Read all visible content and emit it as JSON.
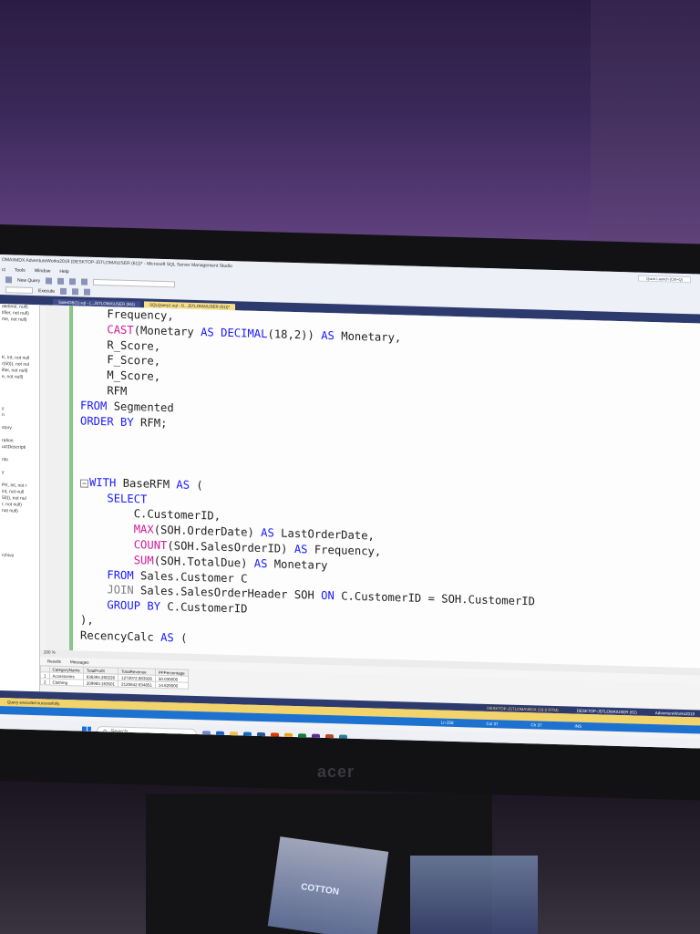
{
  "window": {
    "title": "OMAI\\MDX AdventureWorks2019 (DESKTOP-J5TLOMA\\USER (61))* - Microsoft SQL Server Management Studio",
    "quick_launch": "Quick Launch (Ctrl+Q)"
  },
  "menu": [
    "ct",
    "Tools",
    "Window",
    "Help"
  ],
  "toolbar": {
    "new_query": "New Query",
    "execute": "Execute"
  },
  "tabs": [
    {
      "label": "SalesDB(1).sql - (...J5TLOMA\\USER (65))",
      "active": false
    },
    {
      "label": "SQLQuery1.sql - D...J5TLOMA\\USER (61))*",
      "active": true
    }
  ],
  "object_explorer": {
    "lines": [
      "atetime, null)",
      "tifier, not null)",
      "me, not null)",
      "",
      "",
      "",
      "",
      "",
      "K, int, not null",
      "r(50)), not nul",
      "ifier, not null)",
      "e, not null)",
      "",
      "",
      "",
      "",
      "y",
      "n",
      "",
      "story",
      "",
      "ration",
      "uctDescripti",
      "",
      "nto",
      "",
      "y",
      "",
      "PK, int, not r",
      "int, not null",
      "50)), not nul",
      "r, not null)",
      " not null)",
      "",
      "",
      "",
      "",
      "",
      "",
      "rchive"
    ]
  },
  "code_lines": [
    "    Frequency,",
    "    CAST(Monetary AS DECIMAL(18,2)) AS Monetary,",
    "    R_Score,",
    "    F_Score,",
    "    M_Score,",
    "    RFM",
    "FROM Segmented",
    "ORDER BY RFM;",
    "",
    "",
    "",
    "WITH BaseRFM AS (",
    "    SELECT",
    "        C.CustomerID,",
    "        MAX(SOH.OrderDate) AS LastOrderDate,",
    "        COUNT(SOH.SalesOrderID) AS Frequency,",
    "        SUM(SOH.TotalDue) AS Monetary",
    "    FROM Sales.Customer C",
    "    JOIN Sales.SalesOrderHeader SOH ON C.CustomerID = SOH.CustomerID",
    "    GROUP BY C.CustomerID",
    "),",
    "RecencyCalc AS ("
  ],
  "zoom": "200 %",
  "results": {
    "tabs": [
      "Results",
      "Messages"
    ],
    "columns": [
      "",
      "CategoryName",
      "TotalProfit",
      "TotalRevenue",
      "PFPercentage"
    ],
    "rows": [
      [
        "1",
        "Accessories",
        "636394.260226",
        "1272072.883926",
        "50.030000"
      ],
      [
        "2",
        "Clothing",
        "209983.163501",
        "2120642.634851",
        "14.620000"
      ]
    ]
  },
  "connection_bar": {
    "server": "DESKTOP-J5TLOMA\\MDX (16.0 RTM)",
    "user": "DESKTOP-J5TLOMA\\USER (61)",
    "db": "AdventureWorks2019"
  },
  "status": "Query executed successfully.",
  "position": {
    "ln": "Ln 258",
    "col": "Col 37",
    "ch": "Ch 37",
    "ins": "INS"
  },
  "taskbar": {
    "search_placeholder": "Search"
  },
  "monitor_brand": "acer",
  "colors": {
    "keyword": "#1a1aff",
    "function": "#d0199a",
    "statusbar": "#1d72d0",
    "tab_active": "#f8e08a"
  }
}
